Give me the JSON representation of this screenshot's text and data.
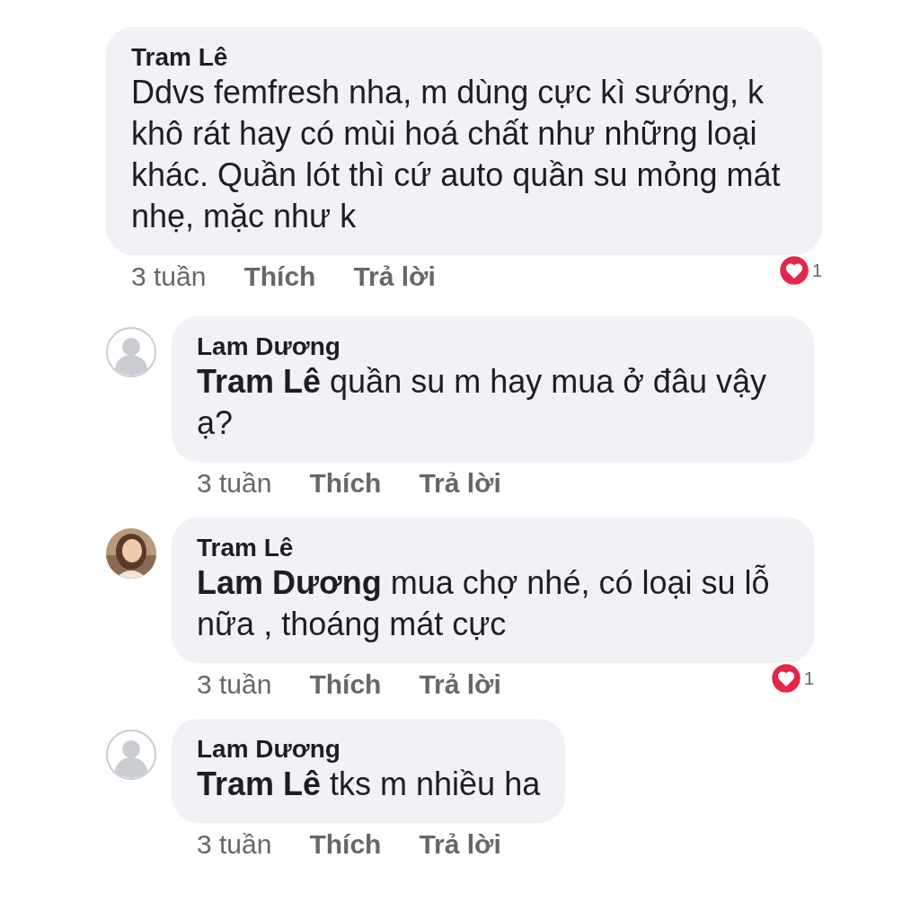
{
  "comments": [
    {
      "author": "Tram Lê",
      "text": "Ddvs femfresh nha, m dùng cực kì sướng, k khô rát hay có mùi hoá chất như những loại khác. Quần lót thì cứ auto quần su mỏng mát nhẹ, mặc như k",
      "time": "3 tuần",
      "like": "Thích",
      "reply": "Trả lời",
      "reactions": "1",
      "children": [
        {
          "author": "Lam Dương",
          "avatar": {
            "kind": "placeholder"
          },
          "text": "**Tram Lê** quần su m hay mua ở đâu vậy ạ?",
          "time": "3 tuần",
          "like": "Thích",
          "reply": "Trả lời"
        },
        {
          "author": "Tram Lê",
          "text": "**Lam Dương** mua chợ nhé, có loại su lỗ nữa , thoáng mát cực",
          "time": "3 tuần",
          "like": "Thích",
          "reply": "Trả lời",
          "reactions": "1"
        },
        {
          "author": "Lam Dương",
          "avatar": {
            "kind": "placeholder"
          },
          "text": "**Tram Lê** tks m nhiều ha",
          "time": "3 tuần",
          "like": "Thích",
          "reply": "Trả lời"
        }
      ]
    }
  ]
}
